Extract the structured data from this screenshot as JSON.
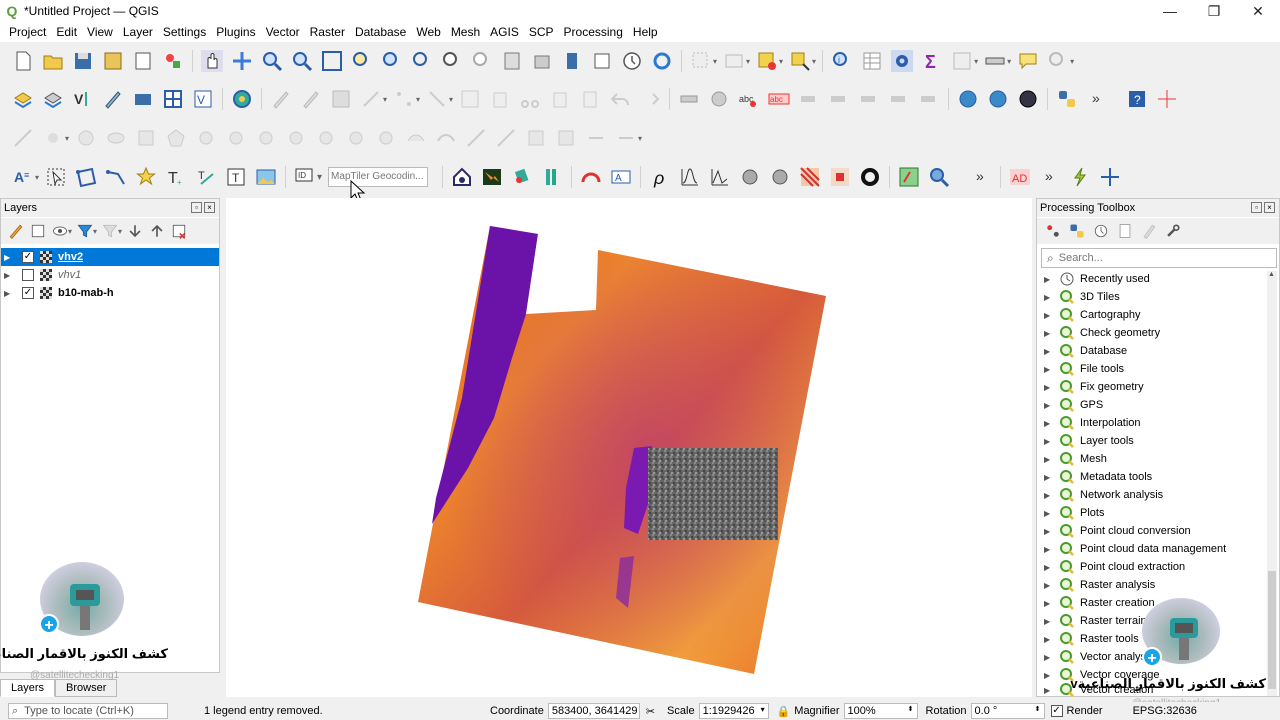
{
  "window": {
    "title": "*Untitled Project — QGIS",
    "app_icon": "Q",
    "controls": [
      "—",
      "❐",
      "✕"
    ]
  },
  "menu": [
    "Project",
    "Edit",
    "View",
    "Layer",
    "Settings",
    "Plugins",
    "Vector",
    "Raster",
    "Database",
    "Web",
    "Mesh",
    "AGIS",
    "SCP",
    "Processing",
    "Help"
  ],
  "toolbar": {
    "geocoder_placeholder": "MapTiler Geocodin..."
  },
  "layers_panel": {
    "title": "Layers",
    "items": [
      {
        "name": "vhv2",
        "checked": "✓",
        "selected": true
      },
      {
        "name": "vhv1",
        "checked": "",
        "selected": false
      },
      {
        "name": "b10-mab-h",
        "checked": "✓",
        "selected": false
      }
    ],
    "tabs": [
      "Layers",
      "Browser"
    ]
  },
  "processing_toolbox": {
    "title": "Processing Toolbox",
    "search_placeholder": "Search...",
    "items": [
      "Recently used",
      "3D Tiles",
      "Cartography",
      "Check geometry",
      "Database",
      "File tools",
      "Fix geometry",
      "GPS",
      "Interpolation",
      "Layer tools",
      "Mesh",
      "Metadata tools",
      "Network analysis",
      "Plots",
      "Point cloud conversion",
      "Point cloud data management",
      "Point cloud extraction",
      "Raster analysis",
      "Raster creation",
      "Raster terrain",
      "Raster tools",
      "Vector analysis",
      "Vector coverage",
      "Vector creation"
    ]
  },
  "overlay": {
    "channel_text": "كشف الكنوز بالاقمار الصناعية",
    "watermark": "@satellitechecking1",
    "plus": "+"
  },
  "statusbar": {
    "locate_placeholder": "Type to locate (Ctrl+K)",
    "message": "1 legend entry removed.",
    "coordinate_label": "Coordinate",
    "coordinate_value": "583400, 3641429",
    "scale_label": "Scale",
    "scale_value": "1:1929426",
    "magnifier_label": "Magnifier",
    "magnifier_value": "100%",
    "rotation_label": "Rotation",
    "rotation_value": "0.0 °",
    "render_label": "Render",
    "render_checked": "✓",
    "crs": "EPSG:32636"
  },
  "colors": {
    "selection": "#0078d7",
    "raster_purple": "#6b12a8",
    "raster_orange": "#f08a2a"
  }
}
